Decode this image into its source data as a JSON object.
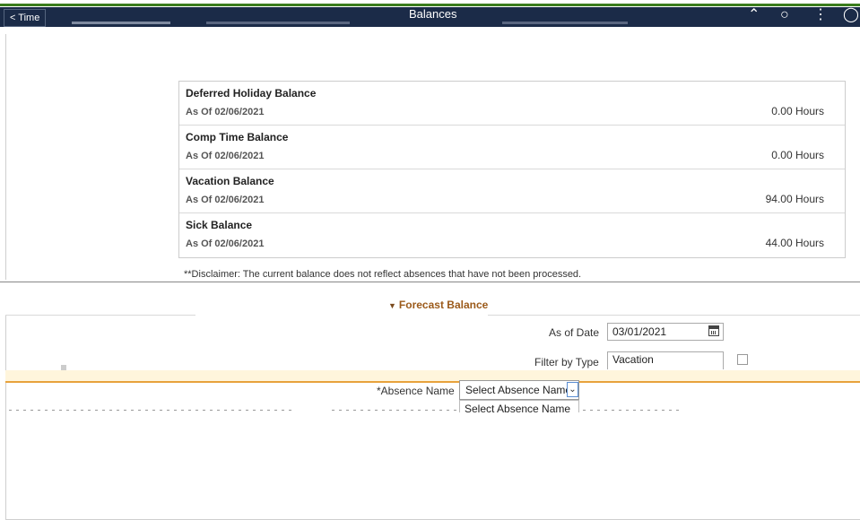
{
  "header": {
    "back_label": "< Time",
    "title": "Balances",
    "icons": [
      "home-icon",
      "search-icon",
      "more-actions-icon",
      "nav-compass-icon"
    ]
  },
  "balances": [
    {
      "name": "Deferred Holiday Balance",
      "as_of": "As Of 02/06/2021",
      "value": "0.00 Hours"
    },
    {
      "name": "Comp Time Balance",
      "as_of": "As Of 02/06/2021",
      "value": "0.00 Hours"
    },
    {
      "name": "Vacation Balance",
      "as_of": "As Of 02/06/2021",
      "value": "94.00 Hours"
    },
    {
      "name": "Sick Balance",
      "as_of": "As Of 02/06/2021",
      "value": "44.00 Hours"
    }
  ],
  "disclaimer": "**Disclaimer: The current balance does not reflect absences that have not been processed.",
  "forecast": {
    "section_title": "Forecast Balance",
    "as_of_label": "As of Date",
    "as_of_value": "03/01/2021",
    "filter_label": "Filter by Type",
    "filter_value": "Vacation",
    "absence_label": "*Absence Name",
    "absence_selected": "Select Absence Name",
    "absence_options": [
      "Select Absence Name"
    ]
  },
  "colors": {
    "header_bg": "#1b2b48",
    "accent_green": "#3a7d1d",
    "section_title": "#9b5a1a",
    "orange_rule": "#e8a23c"
  }
}
